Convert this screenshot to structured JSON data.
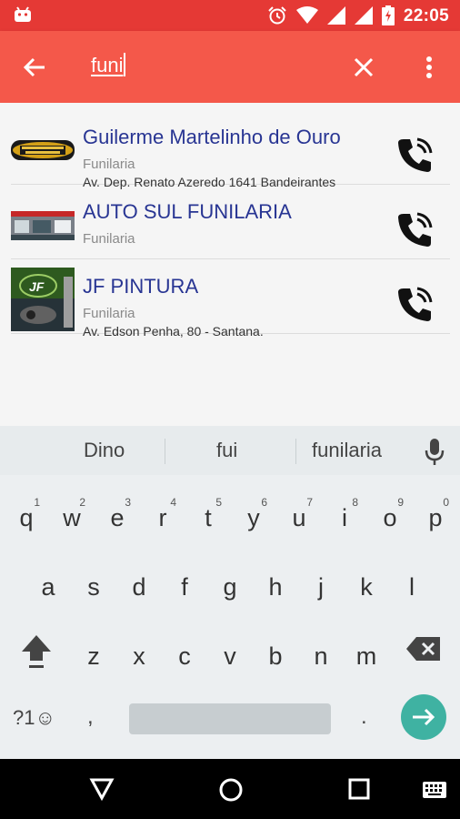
{
  "status_bar": {
    "time": "22:05"
  },
  "search": {
    "query": "funi"
  },
  "results": [
    {
      "name": "Guilerme Martelinho de Ouro",
      "category": "Funilaria",
      "address": "Av. Dep. Renato Azeredo 1641  Bandeirantes"
    },
    {
      "name": "AUTO SUL FUNILARIA",
      "category": "Funilaria",
      "address": ""
    },
    {
      "name": "JF PINTURA",
      "category": "Funilaria",
      "address": "Av. Edson Penha, 80 - Santana."
    }
  ],
  "suggestions": [
    "Dino",
    "fui",
    "funilaria"
  ],
  "keyboard": {
    "row1": [
      "q",
      "w",
      "e",
      "r",
      "t",
      "y",
      "u",
      "i",
      "o",
      "p"
    ],
    "row1_numbers": [
      "1",
      "2",
      "3",
      "4",
      "5",
      "6",
      "7",
      "8",
      "9",
      "0"
    ],
    "row2": [
      "a",
      "s",
      "d",
      "f",
      "g",
      "h",
      "j",
      "k",
      "l"
    ],
    "row3": [
      "z",
      "x",
      "c",
      "v",
      "b",
      "n",
      "m"
    ],
    "symbols_label": "?1☺",
    "comma": ",",
    "period": "."
  },
  "logo_text": {
    "row1": "MARTELINHO DE OURO",
    "row3": "JF"
  },
  "colors": {
    "status_bar": "#e53935",
    "toolbar": "#f4584a",
    "title_text": "#283593",
    "go_button": "#3fb2a2"
  }
}
